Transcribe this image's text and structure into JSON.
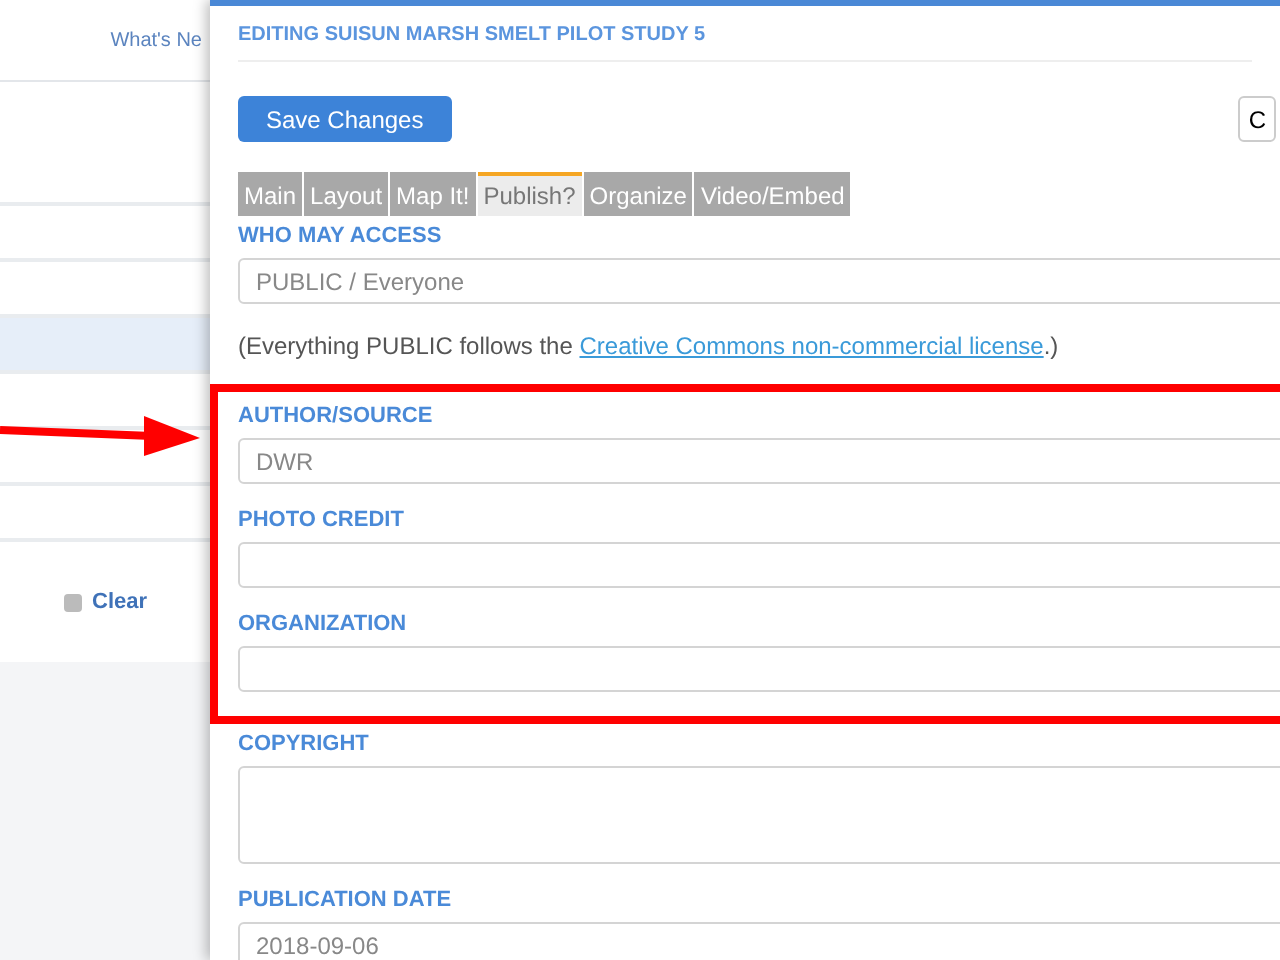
{
  "background": {
    "nav_link": "What's Ne",
    "clear_link": "Clear"
  },
  "modal": {
    "title": "EDITING SUISUN MARSH SMELT PILOT STUDY 5",
    "save_button": "Save Changes",
    "other_button": "C",
    "tabs": [
      {
        "label": "Main",
        "selected": false
      },
      {
        "label": "Layout",
        "selected": false
      },
      {
        "label": "Map It!",
        "selected": false
      },
      {
        "label": "Publish?",
        "selected": true
      },
      {
        "label": "Organize",
        "selected": false
      },
      {
        "label": "Video/Embed",
        "selected": false
      }
    ],
    "items": [
      {
        "kind": "field",
        "label": "WHO MAY ACCESS",
        "value": "PUBLIC / Everyone",
        "highlighted": false
      },
      {
        "kind": "note",
        "text": "(Everything PUBLIC follows the ",
        "link": "Creative Commons non-commercial license",
        "after": ".)",
        "highlighted": false
      },
      {
        "kind": "field",
        "label": "AUTHOR/SOURCE",
        "value": "DWR",
        "highlighted": true
      },
      {
        "kind": "field",
        "label": "PHOTO CREDIT",
        "value": "",
        "highlighted": true
      },
      {
        "kind": "field",
        "label": "ORGANIZATION",
        "value": "",
        "highlighted": true
      },
      {
        "kind": "textarea",
        "label": "COPYRIGHT",
        "value": "",
        "highlighted": false
      },
      {
        "kind": "field",
        "label": "PUBLICATION DATE",
        "value": "2018-09-06",
        "highlighted": false
      }
    ]
  }
}
